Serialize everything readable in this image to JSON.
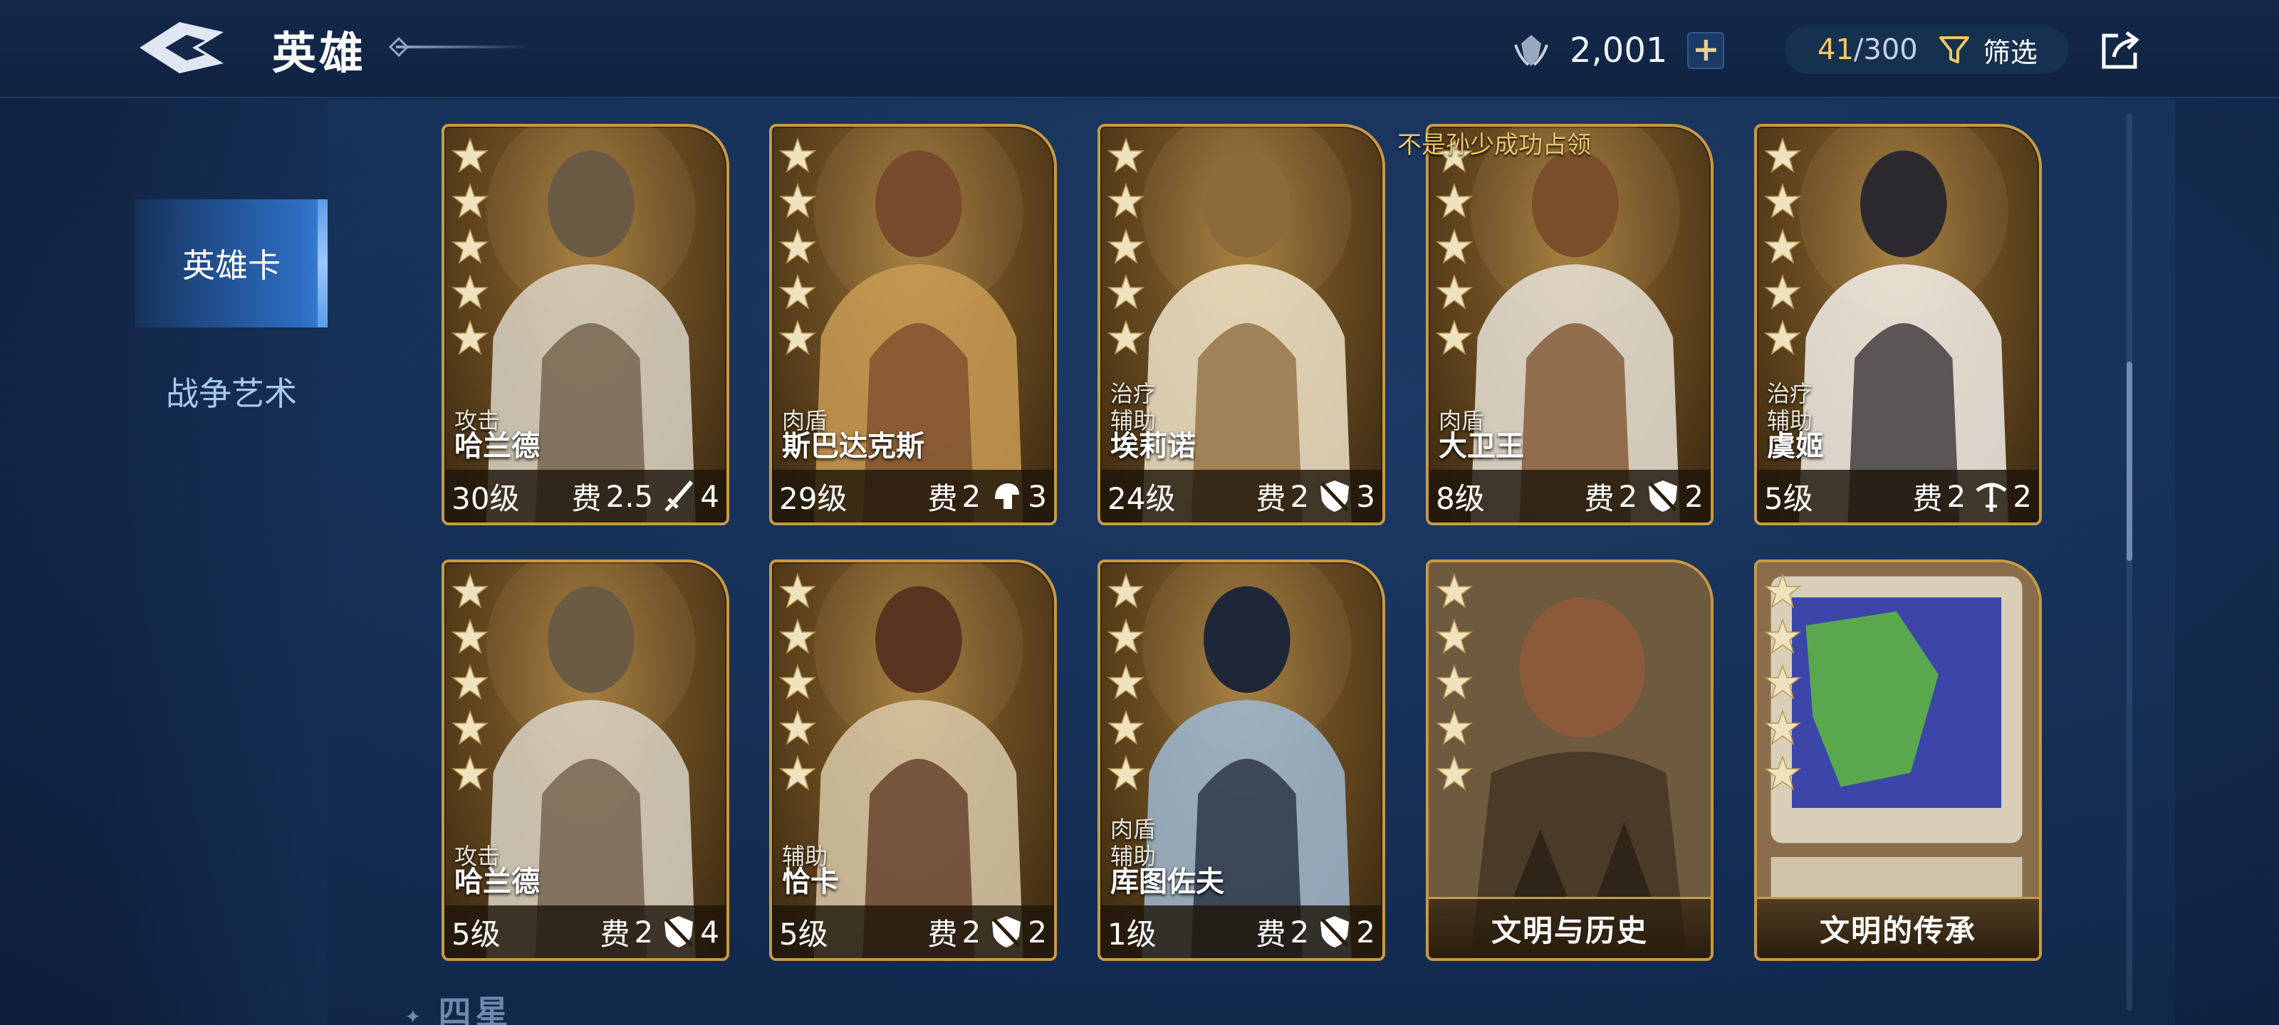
{
  "header": {
    "title": "英雄",
    "currency_value": "2,001",
    "plus_label": "+",
    "hero_count_current": "41",
    "hero_count_max": "/300",
    "filter_label": "筛选"
  },
  "sidebar": {
    "tabs": [
      {
        "label": "英雄卡",
        "active": true
      },
      {
        "label": "战争艺术",
        "active": false
      }
    ]
  },
  "notice_text": "不是孙少成功占领",
  "cards": [
    {
      "roles": [
        "攻击"
      ],
      "name": "哈兰德",
      "level": "30级",
      "cost_label": "费",
      "cost": "2.5",
      "type_icon": "sword-icon",
      "type_value": "4",
      "stars": 5,
      "palette": [
        "#6b5a44",
        "#d9d3c4"
      ]
    },
    {
      "roles": [
        "肉盾"
      ],
      "name": "斯巴达克斯",
      "level": "29级",
      "cost_label": "费",
      "cost": "2",
      "type_icon": "helmet-icon",
      "type_value": "3",
      "stars": 5,
      "palette": [
        "#7a4a2c",
        "#c99b54"
      ]
    },
    {
      "roles": [
        "治疗",
        "辅助"
      ],
      "name": "埃莉诺",
      "level": "24级",
      "cost_label": "费",
      "cost": "2",
      "type_icon": "shield-icon",
      "type_value": "3",
      "stars": 5,
      "palette": [
        "#8c6a3c",
        "#efe3c8"
      ]
    },
    {
      "roles": [
        "肉盾"
      ],
      "name": "大卫王",
      "level": "8级",
      "cost_label": "费",
      "cost": "2",
      "type_icon": "shield-icon",
      "type_value": "2",
      "stars": 5,
      "palette": [
        "#7b4d2a",
        "#e7e2d6"
      ]
    },
    {
      "roles": [
        "治疗",
        "辅助"
      ],
      "name": "虞姬",
      "level": "5级",
      "cost_label": "费",
      "cost": "2",
      "type_icon": "crossbow-icon",
      "type_value": "2",
      "stars": 5,
      "palette": [
        "#2d2a2f",
        "#f3efe9"
      ]
    },
    {
      "roles": [
        "攻击"
      ],
      "name": "哈兰德",
      "level": "5级",
      "cost_label": "费",
      "cost": "2",
      "type_icon": "shield-icon",
      "type_value": "4",
      "stars": 5,
      "palette": [
        "#6b5a44",
        "#d9d3c4"
      ]
    },
    {
      "roles": [
        "辅助"
      ],
      "name": "恰卡",
      "level": "5级",
      "cost_label": "费",
      "cost": "2",
      "type_icon": "shield-icon",
      "type_value": "2",
      "stars": 5,
      "palette": [
        "#5a3420",
        "#d8c9a8"
      ]
    },
    {
      "roles": [
        "肉盾",
        "辅助"
      ],
      "name": "库图佐夫",
      "level": "1级",
      "cost_label": "费",
      "cost": "2",
      "type_icon": "shield-icon",
      "type_value": "2",
      "stars": 5,
      "palette": [
        "#1d2738",
        "#9fb8d2"
      ]
    }
  ],
  "banners": [
    {
      "label": "文明与历史",
      "stars": 5
    },
    {
      "label": "文明的传承",
      "stars": 5
    }
  ],
  "section_label": "四星",
  "colors": {
    "gold": "#c79a45",
    "accent_blue": "#2c6cc0",
    "highlight_gold": "#f1c862"
  }
}
